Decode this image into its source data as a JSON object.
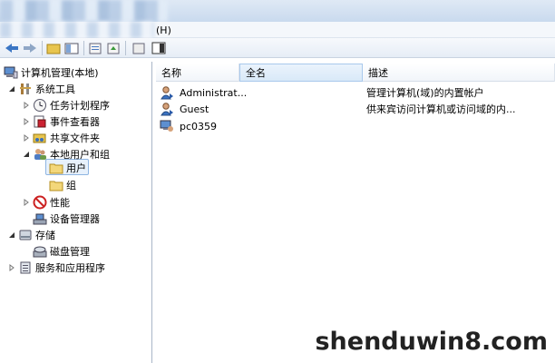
{
  "menu": {
    "help": "(H)"
  },
  "tree": {
    "root": "计算机管理(本地)",
    "items": [
      {
        "label": "系统工具"
      },
      {
        "label": "任务计划程序"
      },
      {
        "label": "事件查看器"
      },
      {
        "label": "共享文件夹"
      },
      {
        "label": "本地用户和组"
      },
      {
        "label": "用户"
      },
      {
        "label": "组"
      },
      {
        "label": "性能"
      },
      {
        "label": "设备管理器"
      },
      {
        "label": "存储"
      },
      {
        "label": "磁盘管理"
      },
      {
        "label": "服务和应用程序"
      }
    ]
  },
  "list": {
    "columns": [
      "名称",
      "全名",
      "描述"
    ],
    "rows": [
      {
        "name": "Administrat...",
        "fullname": "",
        "description": "管理计算机(域)的内置帐户"
      },
      {
        "name": "Guest",
        "fullname": "",
        "description": "供来宾访问计算机或访问域的内..."
      },
      {
        "name": "pc0359",
        "fullname": "",
        "description": ""
      }
    ]
  },
  "watermark": "shenduwin8.com",
  "colors": {
    "selection": "#e7f1fc",
    "selection_border": "#8fb5e2",
    "header_hover": "#d9e9f8"
  }
}
